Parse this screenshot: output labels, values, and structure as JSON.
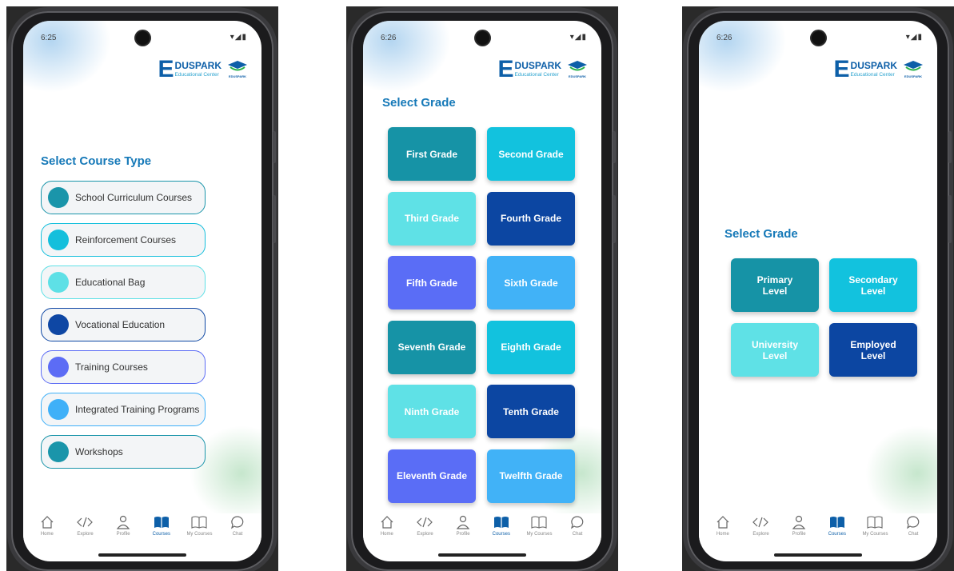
{
  "status": {
    "phone1_time": "6:25",
    "phone2_time": "6:26",
    "phone3_time": "6:26",
    "icons": "▾◢▮"
  },
  "logo": {
    "letter": "E",
    "name": "DUSPARK",
    "subtitle": "Educational Center",
    "emblem_caption": "EDUSPARK"
  },
  "screen1": {
    "title": "Select Course Type",
    "items": [
      {
        "label": "School Curriculum Courses",
        "color": "#1a95aa"
      },
      {
        "label": "Reinforcement Courses",
        "color": "#14bfdc"
      },
      {
        "label": "Educational Bag",
        "color": "#5ee0e6"
      },
      {
        "label": "Vocational Education",
        "color": "#0e47a4"
      },
      {
        "label": "Training Courses",
        "color": "#5c6cf5"
      },
      {
        "label": "Integrated Training Programs",
        "color": "#3fb0f8"
      },
      {
        "label": "Workshops",
        "color": "#1a95aa"
      }
    ]
  },
  "screen2": {
    "title": "Select Grade",
    "grades": [
      {
        "label": "First Grade",
        "color": "#1693a6"
      },
      {
        "label": "Second Grade",
        "color": "#12c2de"
      },
      {
        "label": "Third Grade",
        "color": "#5fe1e6"
      },
      {
        "label": "Fourth Grade",
        "color": "#0c46a2"
      },
      {
        "label": "Fifth Grade",
        "color": "#5a6df6"
      },
      {
        "label": "Sixth Grade",
        "color": "#41b2f7"
      },
      {
        "label": "Seventh Grade",
        "color": "#1693a6"
      },
      {
        "label": "Eighth Grade",
        "color": "#12c2de"
      },
      {
        "label": "Ninth Grade",
        "color": "#5fe1e6"
      },
      {
        "label": "Tenth Grade",
        "color": "#0c46a2"
      },
      {
        "label": "Eleventh Grade",
        "color": "#5a6df6"
      },
      {
        "label": "Twelfth Grade",
        "color": "#41b2f7"
      }
    ]
  },
  "screen3": {
    "title": "Select Grade",
    "levels": [
      {
        "label": "Primary Level",
        "color": "#1693a6"
      },
      {
        "label": "Secondary Level",
        "color": "#12c2de"
      },
      {
        "label": "University Level",
        "color": "#5fe1e6"
      },
      {
        "label": "Employed Level",
        "color": "#0c46a2"
      }
    ]
  },
  "nav": {
    "items": [
      {
        "label": "Home",
        "icon": "home-icon"
      },
      {
        "label": "Explore",
        "icon": "code-icon"
      },
      {
        "label": "Profile",
        "icon": "person-icon"
      },
      {
        "label": "Courses",
        "icon": "book-filled-icon",
        "active": true
      },
      {
        "label": "My Courses",
        "icon": "book-outline-icon"
      },
      {
        "label": "Chat",
        "icon": "chat-icon"
      }
    ],
    "active_color": "#0d5fa8"
  }
}
